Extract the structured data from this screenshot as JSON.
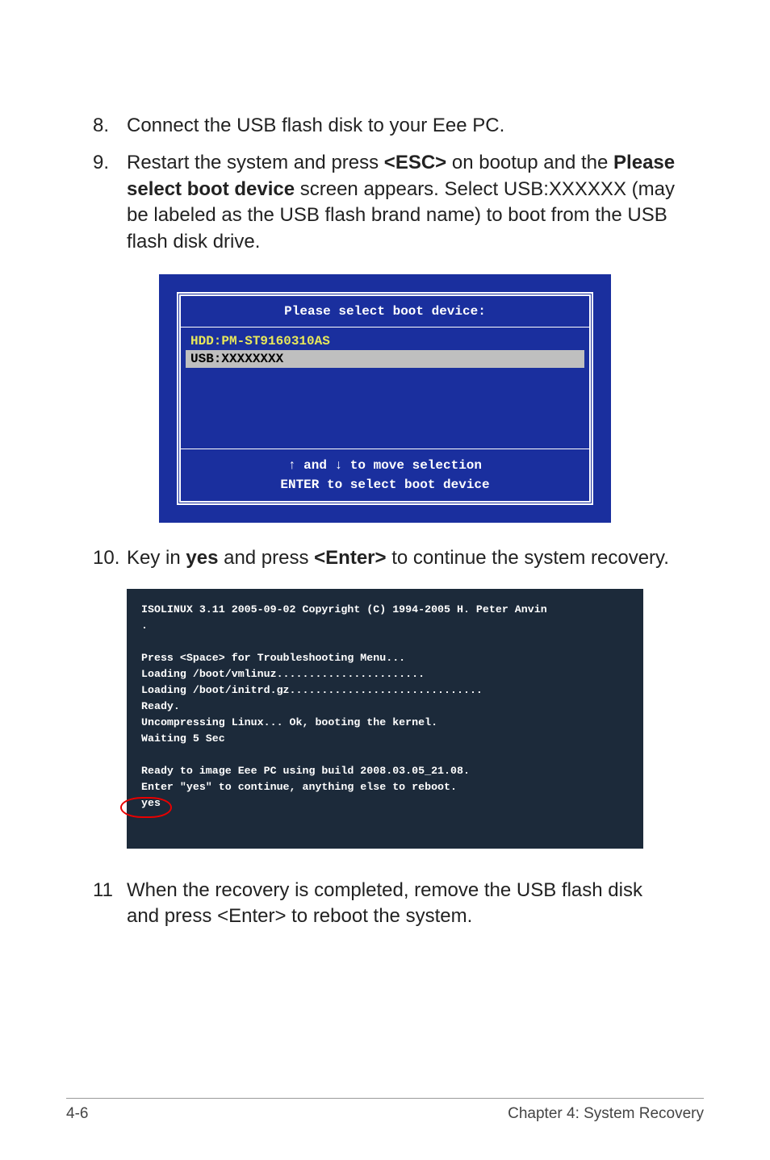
{
  "steps": {
    "s8": {
      "num": "8.",
      "text": "Connect the USB flash disk to your Eee PC."
    },
    "s9": {
      "num": "9.",
      "t1": "Restart the system and press ",
      "b1": "<ESC>",
      "t2": " on bootup and the ",
      "b2": "Please select boot device",
      "t3": " screen appears. Select USB:XXXXXX (may be labeled as the USB flash brand name) to boot from the USB flash disk drive."
    },
    "s10": {
      "num": "10.",
      "t1": "Key in ",
      "b1": "yes",
      "t2": " and press ",
      "b2": "<Enter>",
      "t3": " to continue the system recovery."
    },
    "s11": {
      "num": "11",
      "text": "When the recovery is completed, remove the USB flash disk and press <Enter> to reboot the system."
    }
  },
  "boot": {
    "title": "Please select boot device:",
    "row1": "HDD:PM-ST9160310AS",
    "row2": "USB:XXXXXXXX",
    "footer1": "↑ and ↓ to move selection",
    "footer2": "ENTER to select boot device"
  },
  "term": {
    "l1": "ISOLINUX 3.11 2005-09-02 Copyright (C) 1994-2005 H. Peter Anvin",
    "l2": ".",
    "l3": "",
    "l4": "Press <Space> for Troubleshooting Menu...",
    "l5": "Loading /boot/vmlinuz.......................",
    "l6": "Loading /boot/initrd.gz..............................",
    "l7": "Ready.",
    "l8": "Uncompressing Linux... Ok, booting the kernel.",
    "l9": "Waiting 5 Sec",
    "l10": "",
    "l11": "Ready to image Eee PC using build 2008.03.05_21.08.",
    "l12": "Enter \"yes\" to continue, anything else to reboot.",
    "l13": "yes"
  },
  "footer": {
    "page": "4-6",
    "chapter": "Chapter 4: System Recovery"
  }
}
